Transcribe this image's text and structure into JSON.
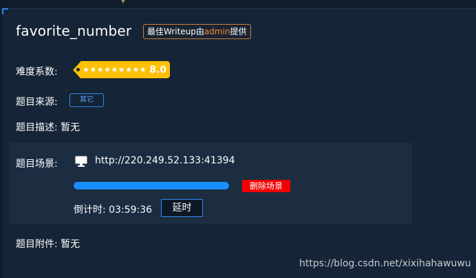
{
  "challenge": {
    "title": "favorite_number",
    "writeup_badge": {
      "prefix": "最佳Writeup由",
      "author": "admin",
      "suffix": "提供"
    }
  },
  "difficulty": {
    "label": "难度系数:",
    "stars": "★★★★★★★★★",
    "score": "8.0"
  },
  "source": {
    "label": "题目来源:",
    "value": "其它"
  },
  "description": {
    "label": "题目描述:",
    "value": "暂无"
  },
  "scene": {
    "label": "题目场景:",
    "icon": "monitor-icon",
    "url": "http://220.249.52.133:41394",
    "delete_label": "删除场景",
    "countdown_label": "倒计时:",
    "countdown_value": "03:59:36",
    "extend_label": "延时",
    "progress_percent": 100
  },
  "attachments": {
    "label": "题目附件:",
    "value": "暂无"
  },
  "watermark": "https://blog.csdn.net/xixihahawuwu",
  "colors": {
    "background": "#152436",
    "accent": "#2f8cf0",
    "difficulty_tag": "#ffc107",
    "delete": "#f00000",
    "writeup_highlight": "#f28a36"
  }
}
